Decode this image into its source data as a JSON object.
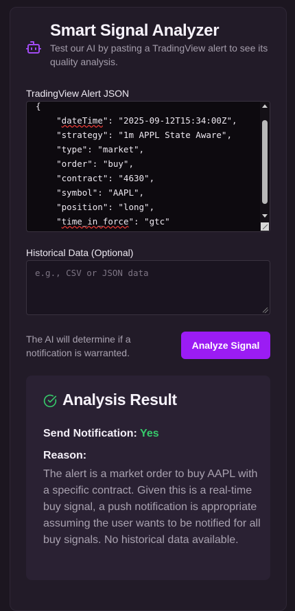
{
  "header": {
    "title": "Smart Signal Analyzer",
    "subtitle": "Test our AI by pasting a TradingView alert to see its quality analysis.",
    "icon": "robot-icon"
  },
  "alert_input": {
    "label": "TradingView Alert JSON",
    "lines": [
      "{",
      "    \"dateTime\": \"2025-09-12T15:34:00Z\",",
      "    \"strategy\": \"1m APPL State Aware\",",
      "    \"type\": \"market\",",
      "    \"order\": \"buy\",",
      "    \"contract\": \"4630\",",
      "    \"symbol\": \"AAPL\",",
      "    \"position\": \"long\",",
      "    \"time_in_force\": \"gtc\"",
      "}"
    ]
  },
  "historical_input": {
    "label": "Historical Data (Optional)",
    "placeholder": "e.g., CSV or JSON data",
    "value": ""
  },
  "actions": {
    "note": "The AI will determine if a notification is warranted.",
    "analyze_label": "Analyze Signal"
  },
  "result": {
    "title": "Analysis Result",
    "icon": "check-circle-icon",
    "send_label": "Send Notification:",
    "send_value": "Yes",
    "send_color": "#36c96a",
    "reason_label": "Reason:",
    "reason_text": "The alert is a market order to buy AAPL with a specific contract. Given this is a real-time buy signal, a push notification is appropriate assuming the user wants to be notified for all buy signals. No historical data available."
  },
  "colors": {
    "accent": "#9b1cf4",
    "background": "#1c1620",
    "card": "#221b28",
    "result_card": "#2a2133"
  }
}
